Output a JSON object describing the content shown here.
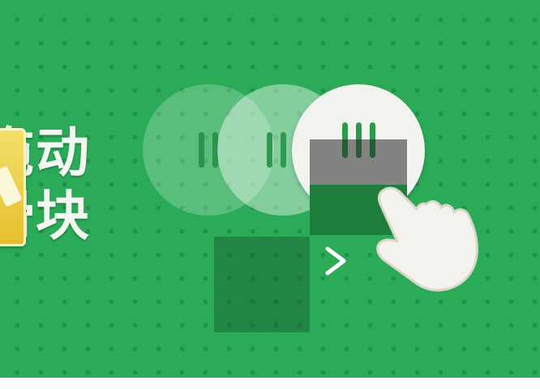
{
  "instruction": {
    "line1": "拖动",
    "line2": "滑块"
  },
  "icons": {
    "badge": "badge-icon",
    "slider_knob": "slider-grip-icon",
    "arrow": "arrow-right-icon",
    "hand": "hand-pointer-icon",
    "target_slot": "puzzle-slot-icon"
  },
  "colors": {
    "background": "#2bab57",
    "knob": "#f2f2ee",
    "grip": "#2c9a4c",
    "text": "#f3f7f2"
  }
}
